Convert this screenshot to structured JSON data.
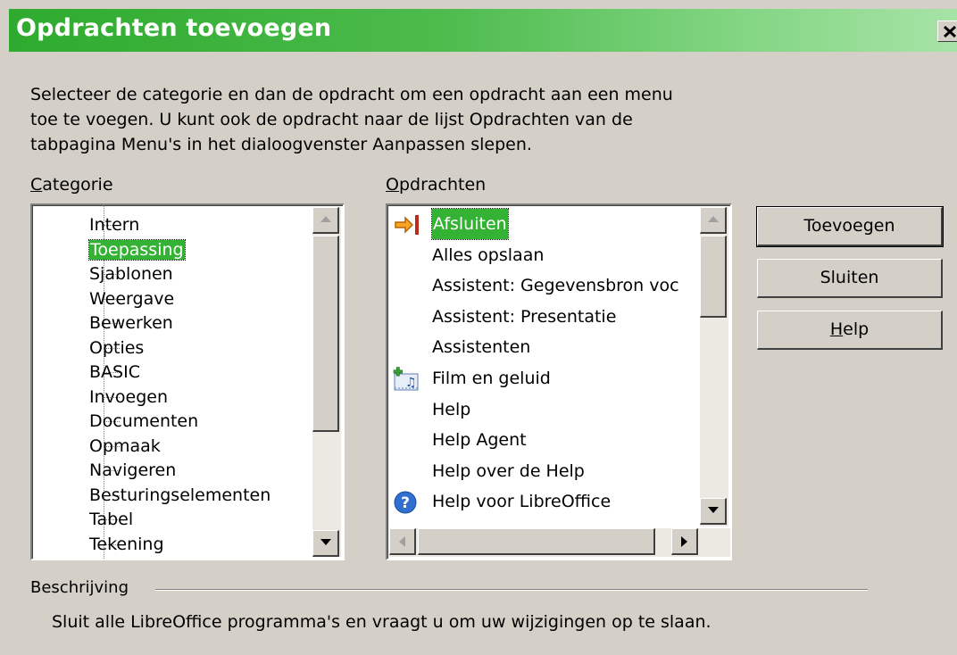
{
  "window": {
    "title": "Opdrachten toevoegen",
    "close_icon": "close-icon"
  },
  "intro": {
    "line1": "Selecteer de categorie en dan de opdracht om een opdracht aan een menu",
    "line2": "toe te voegen. U kunt ook de opdracht naar de lijst Opdrachten van de",
    "line3": "tabpagina Menu's in het dialoogvenster Aanpassen slepen."
  },
  "category": {
    "label_first": "C",
    "label_rest": "ategorie",
    "selected": "Toepassing",
    "items": [
      "Intern",
      "Toepassing",
      "Sjablonen",
      "Weergave",
      "Bewerken",
      "Opties",
      "BASIC",
      "Invoegen",
      "Documenten",
      "Opmaak",
      "Navigeren",
      "Besturingselementen",
      "Tabel",
      "Tekening"
    ]
  },
  "commands": {
    "label_first": "O",
    "label_rest": "pdrachten",
    "selected": "Afsluiten",
    "items": [
      {
        "label": "Afsluiten",
        "icon": "exit-arrow-icon"
      },
      {
        "label": "Alles opslaan",
        "icon": ""
      },
      {
        "label": "Assistent: Gegevensbron voc",
        "icon": ""
      },
      {
        "label": "Assistent: Presentatie",
        "icon": ""
      },
      {
        "label": "Assistenten",
        "icon": ""
      },
      {
        "label": "Film en geluid",
        "icon": "media-icon"
      },
      {
        "label": "Help",
        "icon": ""
      },
      {
        "label": "Help Agent",
        "icon": ""
      },
      {
        "label": "Help over de Help",
        "icon": ""
      },
      {
        "label": "Help voor LibreOffice",
        "icon": "help-icon"
      }
    ]
  },
  "buttons": {
    "add": "Toevoegen",
    "close": "Sluiten",
    "help_first": "H",
    "help_rest": "elp"
  },
  "description": {
    "label": "Beschrijving",
    "text": "Sluit alle LibreOffice programma's en vraagt u om uw wijzigingen op te slaan."
  },
  "colors": {
    "title_gradient_start": "#2eab2e",
    "title_gradient_end": "#a7e3a7",
    "selection": "#33b233",
    "dialog_bg": "#d4d0c8"
  }
}
